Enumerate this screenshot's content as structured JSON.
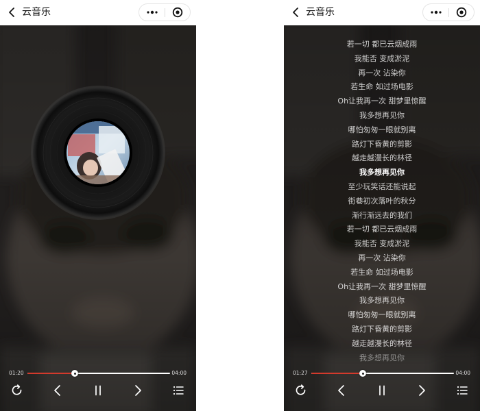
{
  "app": {
    "title": "云音乐"
  },
  "colors": {
    "accent": "#d33a2c",
    "background": "#1e1e1e",
    "track": "#ffffff"
  },
  "icons": {
    "back": "chevron-left-icon",
    "more": "more-dots-icon",
    "close": "target-circle-icon",
    "loop": "repeat-icon",
    "prev": "chevron-left-icon",
    "play": "pause-icon",
    "next": "chevron-right-icon",
    "list": "playlist-icon"
  },
  "screens": {
    "cover": {
      "current_time": "01:20",
      "total_time": "04:00",
      "progress": 0.333
    },
    "lyrics": {
      "current_time": "01:27",
      "total_time": "04:00",
      "progress": 0.3625,
      "active_index": 9,
      "lines": [
        "若一切 都已云烟成雨",
        "我能否 变成淤泥",
        "再一次 沾染你",
        "若生命 如过场电影",
        "Oh让我再一次 甜梦里惊醒",
        "我多想再见你",
        "哪怕匆匆一眼就别离",
        "路灯下昏黄的剪影",
        "越走越漫长的林径",
        "我多想再见你",
        "至少玩笑话还能说起",
        "街巷初次落叶的秋分",
        "渐行渐远去的我们",
        "若一切 都已云烟成雨",
        "我能否 变成淤泥",
        "再一次 沾染你",
        "若生命 如过场电影",
        "Oh让我再一次 甜梦里惊醒",
        "我多想再见你",
        "哪怕匆匆一眼就别离",
        "路灯下昏黄的剪影",
        "越走越漫长的林径",
        "我多想再见你"
      ]
    }
  }
}
